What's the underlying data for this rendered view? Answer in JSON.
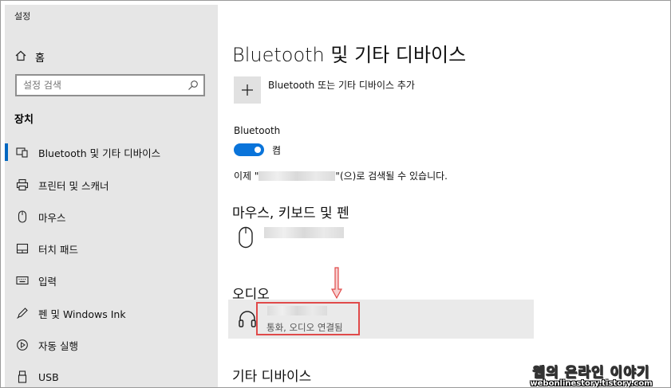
{
  "window": {
    "title": "설정"
  },
  "sidebar": {
    "home_label": "홈",
    "search_placeholder": "설정 검색",
    "section_title": "장치",
    "items": [
      {
        "label": "Bluetooth 및 기타 디바이스",
        "icon": "bluetooth-devices-icon",
        "active": true
      },
      {
        "label": "프린터 및 스캐너",
        "icon": "printer-icon"
      },
      {
        "label": "마우스",
        "icon": "mouse-icon"
      },
      {
        "label": "터치 패드",
        "icon": "touchpad-icon"
      },
      {
        "label": "입력",
        "icon": "keyboard-icon"
      },
      {
        "label": "펜 및 Windows Ink",
        "icon": "pen-icon"
      },
      {
        "label": "자동 실행",
        "icon": "autoplay-icon"
      },
      {
        "label": "USB",
        "icon": "usb-icon"
      }
    ]
  },
  "main": {
    "title": "Bluetooth 및 기타 디바이스",
    "add_device_label": "Bluetooth 또는 기타 디바이스 추가",
    "bluetooth_label": "Bluetooth",
    "toggle_state": "켬",
    "discoverable_prefix": "이제 \"",
    "discoverable_suffix": "\"(으)로 검색될 수 있습니다.",
    "mouse_section": "마우스, 키보드 및 펜",
    "audio_section": "오디오",
    "audio_device_status": "통화, 오디오 연결됨",
    "other_section": "기타 디바이스"
  },
  "colors": {
    "accent": "#0a74da",
    "highlight": "#e04a4a",
    "sidebar_bg": "#e6e6e6"
  },
  "watermark": {
    "line1": "웹의 온라인 이야기",
    "line2": "webonlinestory.tistory.com"
  }
}
